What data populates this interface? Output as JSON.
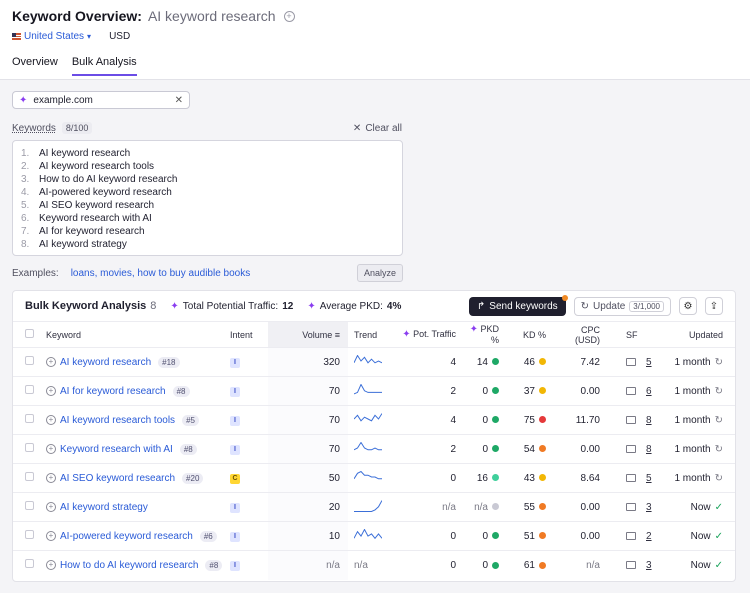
{
  "header": {
    "title": "Keyword Overview:",
    "subtitle": "AI keyword research",
    "region": "United States",
    "currency": "USD"
  },
  "tabs": [
    {
      "label": "Overview",
      "active": false
    },
    {
      "label": "Bulk Analysis",
      "active": true
    }
  ],
  "domain": {
    "value": "example.com"
  },
  "keywords_input": {
    "label": "Keywords",
    "count": "8/100",
    "clear_label": "Clear all",
    "items": [
      "AI keyword research",
      "AI keyword research tools",
      "How to do AI keyword research",
      "AI-powered keyword research",
      "AI SEO keyword research",
      "Keyword research with AI",
      "AI for keyword research",
      "AI keyword strategy"
    ]
  },
  "examples": {
    "label": "Examples:",
    "links": "loans, movies, how to buy audible books",
    "analyze_label": "Analyze"
  },
  "panel": {
    "title": "Bulk Keyword Analysis",
    "count": "8",
    "potential_traffic_label": "Total Potential Traffic:",
    "potential_traffic_value": "12",
    "avg_pkd_label": "Average PKD:",
    "avg_pkd_value": "4%",
    "send_label": "Send keywords",
    "update_label": "Update",
    "update_count": "3/1,000"
  },
  "columns": {
    "keyword": "Keyword",
    "intent": "Intent",
    "volume": "Volume",
    "trend": "Trend",
    "pot_traffic": "Pot. Traffic",
    "pkd": "PKD %",
    "kd": "KD %",
    "cpc": "CPC (USD)",
    "sf": "SF",
    "updated": "Updated"
  },
  "colors": {
    "green": "#1ea866",
    "teal": "#3fcf9b",
    "yellow": "#f2b705",
    "orange": "#f07a24",
    "red": "#e5393a",
    "gray": "#c9c9d4"
  },
  "rows": [
    {
      "keyword": "AI keyword research",
      "position": "#18",
      "intent": "I",
      "volume": "320",
      "trend": [
        2,
        6,
        3,
        5,
        2,
        4,
        2,
        3,
        2
      ],
      "pot": "4",
      "pkd": "14",
      "pkd_color": "green",
      "kd": "46",
      "kd_color": "yellow",
      "cpc": "7.42",
      "sf": "5",
      "updated": "1 month",
      "upd_icon": "refresh"
    },
    {
      "keyword": "AI for keyword research",
      "position": "#8",
      "intent": "I",
      "volume": "70",
      "trend": [
        1,
        2,
        7,
        3,
        2,
        2,
        2,
        2,
        2
      ],
      "pot": "2",
      "pkd": "0",
      "pkd_color": "green",
      "kd": "37",
      "kd_color": "yellow",
      "cpc": "0.00",
      "sf": "6",
      "updated": "1 month",
      "upd_icon": "refresh"
    },
    {
      "keyword": "AI keyword research tools",
      "position": "#5",
      "intent": "I",
      "volume": "70",
      "trend": [
        3,
        5,
        2,
        4,
        3,
        2,
        5,
        3,
        6
      ],
      "pot": "4",
      "pkd": "0",
      "pkd_color": "green",
      "kd": "75",
      "kd_color": "red",
      "cpc": "11.70",
      "sf": "8",
      "updated": "1 month",
      "upd_icon": "refresh"
    },
    {
      "keyword": "Keyword research with AI",
      "position": "#8",
      "intent": "I",
      "volume": "70",
      "trend": [
        2,
        3,
        6,
        3,
        2,
        2,
        3,
        2,
        2
      ],
      "pot": "2",
      "pkd": "0",
      "pkd_color": "green",
      "kd": "54",
      "kd_color": "orange",
      "cpc": "0.00",
      "sf": "8",
      "updated": "1 month",
      "upd_icon": "refresh"
    },
    {
      "keyword": "AI SEO keyword research",
      "position": "#20",
      "intent": "C",
      "volume": "50",
      "trend": [
        2,
        5,
        6,
        4,
        4,
        3,
        3,
        2,
        2
      ],
      "pot": "0",
      "pkd": "16",
      "pkd_color": "teal",
      "kd": "43",
      "kd_color": "yellow",
      "cpc": "8.64",
      "sf": "5",
      "updated": "1 month",
      "upd_icon": "refresh"
    },
    {
      "keyword": "AI keyword strategy",
      "position": "",
      "intent": "I",
      "volume": "20",
      "trend": [
        0,
        0,
        0,
        0,
        0,
        0,
        1,
        3,
        7
      ],
      "pot": "n/a",
      "pkd": "n/a",
      "pkd_color": "gray",
      "kd": "55",
      "kd_color": "orange",
      "cpc": "0.00",
      "sf": "3",
      "updated": "Now",
      "upd_icon": "check"
    },
    {
      "keyword": "AI-powered keyword research",
      "position": "#6",
      "intent": "I",
      "volume": "10",
      "trend": [
        1,
        4,
        2,
        5,
        2,
        3,
        1,
        3,
        1
      ],
      "pot": "0",
      "pkd": "0",
      "pkd_color": "green",
      "kd": "51",
      "kd_color": "orange",
      "cpc": "0.00",
      "sf": "2",
      "updated": "Now",
      "upd_icon": "check"
    },
    {
      "keyword": "How to do AI keyword research",
      "position": "#8",
      "intent": "I",
      "volume": "n/a",
      "trend": null,
      "trend_text": "n/a",
      "pot": "0",
      "pkd": "0",
      "pkd_color": "green",
      "kd": "61",
      "kd_color": "orange",
      "cpc": "n/a",
      "sf": "3",
      "updated": "Now",
      "upd_icon": "check"
    }
  ]
}
